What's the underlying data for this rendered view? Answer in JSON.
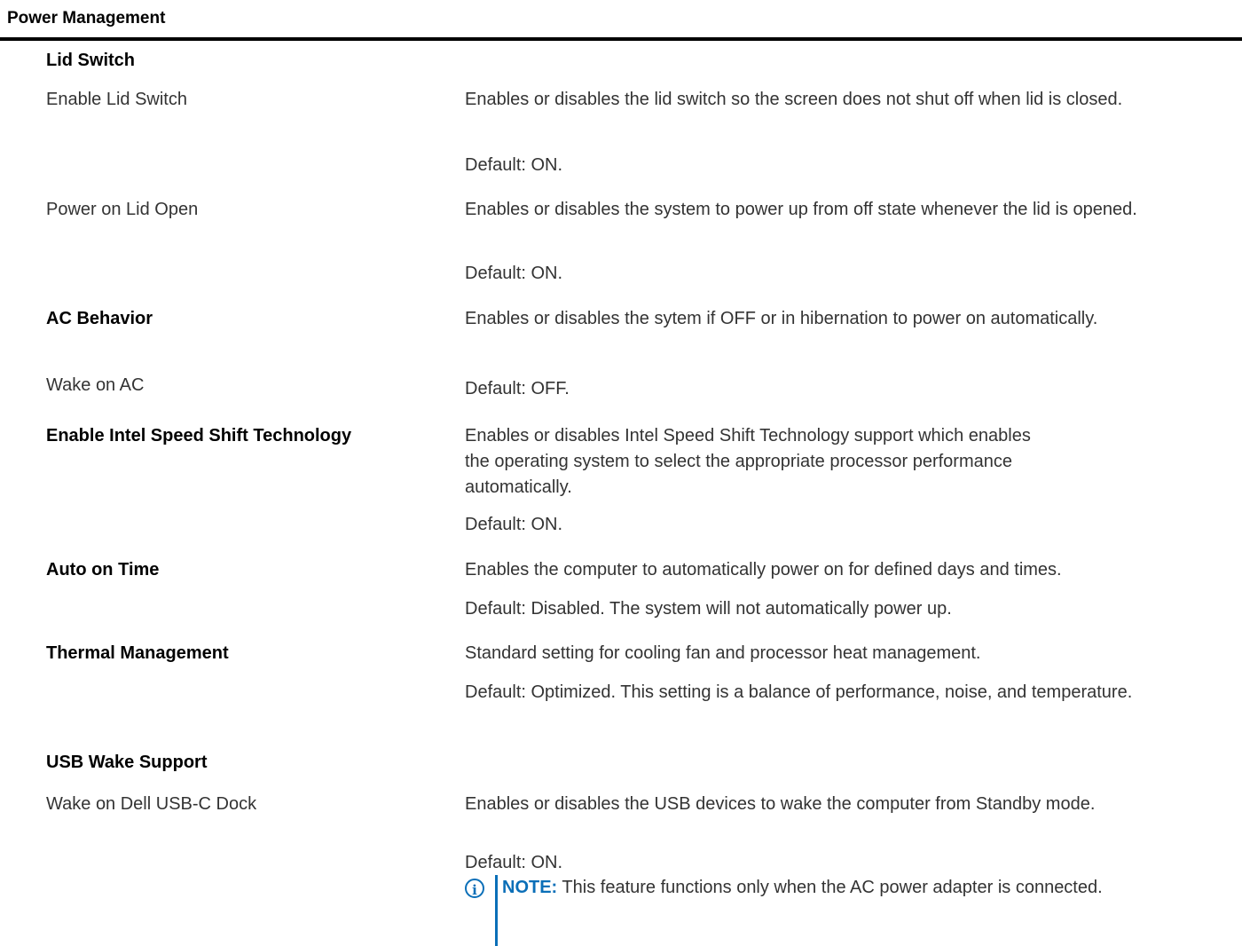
{
  "header": {
    "title": "Power Management"
  },
  "sections": {
    "lid_switch": {
      "heading": "Lid Switch",
      "enable_lid_switch": {
        "label": "Enable Lid Switch",
        "description": "Enables or disables the lid switch so the screen does not shut off when lid is closed.",
        "default": "Default: ON."
      },
      "power_on_lid_open": {
        "label": "Power on Lid Open",
        "description": "Enables or disables the system to power up from off state whenever the lid is opened.",
        "default": "Default: ON."
      }
    },
    "ac_behavior": {
      "heading": "AC Behavior",
      "description": "Enables or disables the sytem if OFF or in hibernation to power on automatically.",
      "wake_on_ac": {
        "label": "Wake on AC",
        "default": "Default: OFF."
      }
    },
    "speed_shift": {
      "heading": "Enable Intel Speed Shift Technology",
      "description_lines": [
        "Enables or disables Intel Speed Shift Technology support which enables",
        "the operating system to select the appropriate processor performance",
        "automatically."
      ],
      "default": "Default: ON."
    },
    "auto_on_time": {
      "heading": "Auto on Time",
      "description": "Enables the computer to automatically power on for defined days and times.",
      "default": "Default: Disabled. The system will not automatically power up."
    },
    "thermal": {
      "heading": "Thermal Management",
      "description": "Standard setting for cooling fan and processor heat management.",
      "default": "Default: Optimized. This setting is a balance of performance, noise, and temperature."
    },
    "usb_wake": {
      "heading": "USB Wake Support",
      "wake_on_dock": {
        "label": "Wake on Dell USB-C Dock",
        "description": "Enables or disables the USB devices to wake the computer from Standby mode.",
        "default": "Default: ON."
      },
      "note": {
        "icon": "info-icon",
        "label": "NOTE:",
        "text": "This feature functions only when the AC power adapter is connected."
      }
    }
  },
  "colors": {
    "note_accent": "#0b6fb8",
    "header_rule": "#000000"
  }
}
